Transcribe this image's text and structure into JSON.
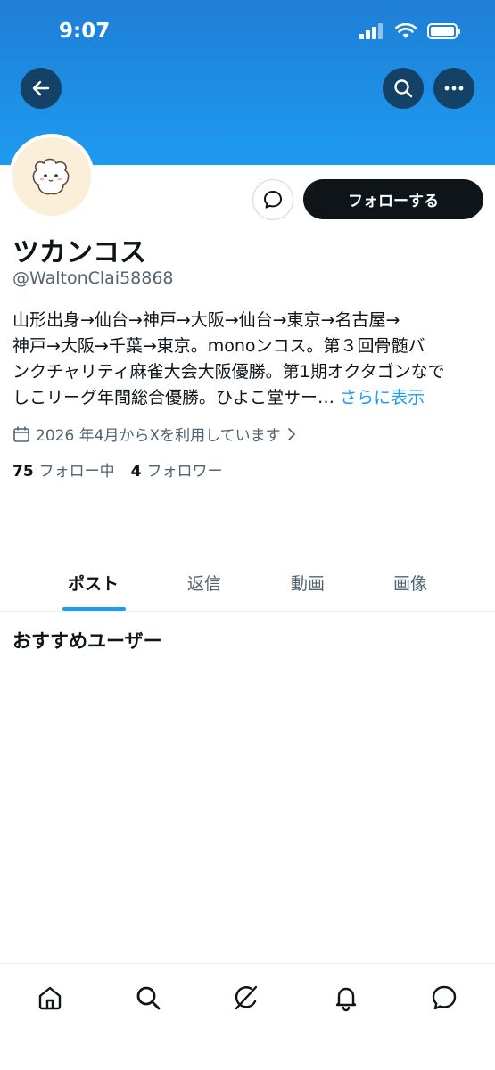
{
  "status_bar": {
    "time": "9:07"
  },
  "profile": {
    "display_name": "ツカンコス",
    "handle": "@WaltonClai58868",
    "bio_lines": [
      "山形出身→仙台→神戸→大阪→仙台→東京→名古屋→",
      "神戸→大阪→千葉→東京。monoンコス。第３回骨髄バ",
      "ンクチャリティ麻雀大会大阪優勝。第1期オクタゴンなで",
      "しこリーグ年間総合優勝。ひよこ堂サー…"
    ],
    "bio_more": "さらに表示",
    "joined": "2026 年4月からXを利用しています",
    "following_count": "75",
    "following_label": "フォロー中",
    "followers_count": "4",
    "followers_label": "フォロワー"
  },
  "actions": {
    "follow_label": "フォローする"
  },
  "tabs": [
    {
      "label": "ポスト",
      "active": true
    },
    {
      "label": "返信",
      "active": false
    },
    {
      "label": "動画",
      "active": false
    },
    {
      "label": "画像",
      "active": false
    }
  ],
  "recommend": {
    "title": "おすすめユーザー"
  },
  "icons": {
    "back": "back-arrow-icon",
    "search": "search-icon",
    "more": "more-icon",
    "message": "message-icon",
    "calendar": "calendar-icon",
    "home": "home-icon",
    "explore": "search-icon",
    "grok": "grok-icon",
    "notifications": "bell-icon",
    "messages": "message-icon"
  },
  "colors": {
    "accent": "#1d9bf0",
    "banner": "#1d9bf0",
    "text": "#0f1419",
    "muted": "#536471"
  }
}
